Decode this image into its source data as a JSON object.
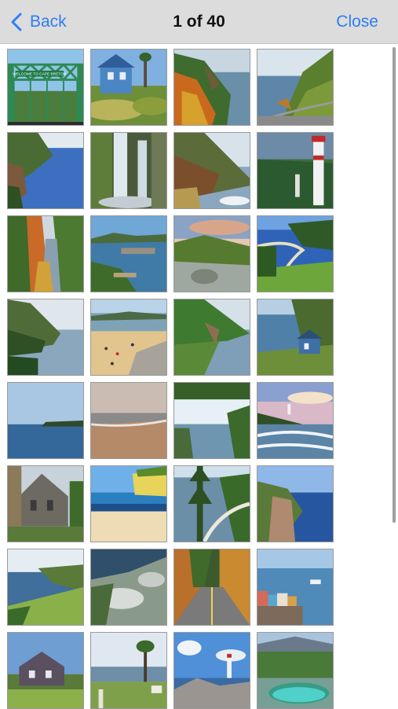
{
  "nav": {
    "back_label": "Back",
    "title": "1 of 40",
    "close_label": "Close",
    "accent_color": "#2f7cf6"
  },
  "sign_text": "WELCOME TO CAPE BRETON",
  "thumbnails": [
    {
      "name": "green-steel-bridge"
    },
    {
      "name": "blue-house-flowers"
    },
    {
      "name": "autumn-coast-cliff"
    },
    {
      "name": "coastal-road-hill"
    },
    {
      "name": "coastal-cliffs-bay"
    },
    {
      "name": "waterfall-rocks"
    },
    {
      "name": "coast-highlands"
    },
    {
      "name": "lighthouse-cliffs"
    },
    {
      "name": "autumn-river-valley"
    },
    {
      "name": "harbour-breakwater"
    },
    {
      "name": "sunset-coast-rocks"
    },
    {
      "name": "golf-course-coast"
    },
    {
      "name": "highland-ridge-sea"
    },
    {
      "name": "busy-beach"
    },
    {
      "name": "cabot-trail-coast"
    },
    {
      "name": "house-on-cliff"
    },
    {
      "name": "calm-sea-island"
    },
    {
      "name": "empty-beach"
    },
    {
      "name": "waterfall-pool"
    },
    {
      "name": "sunset-lighthouse-surf"
    },
    {
      "name": "stone-church"
    },
    {
      "name": "yellow-cliff-beach"
    },
    {
      "name": "tree-coastline"
    },
    {
      "name": "cliff-blue-sea"
    },
    {
      "name": "hillside-bay-view"
    },
    {
      "name": "rocky-hilltop"
    },
    {
      "name": "autumn-road"
    },
    {
      "name": "waterfront-town"
    },
    {
      "name": "victorian-inn"
    },
    {
      "name": "garden-lookout"
    },
    {
      "name": "lighthouse-rocks"
    },
    {
      "name": "turquoise-lagoon"
    }
  ],
  "image_count_total": 40
}
